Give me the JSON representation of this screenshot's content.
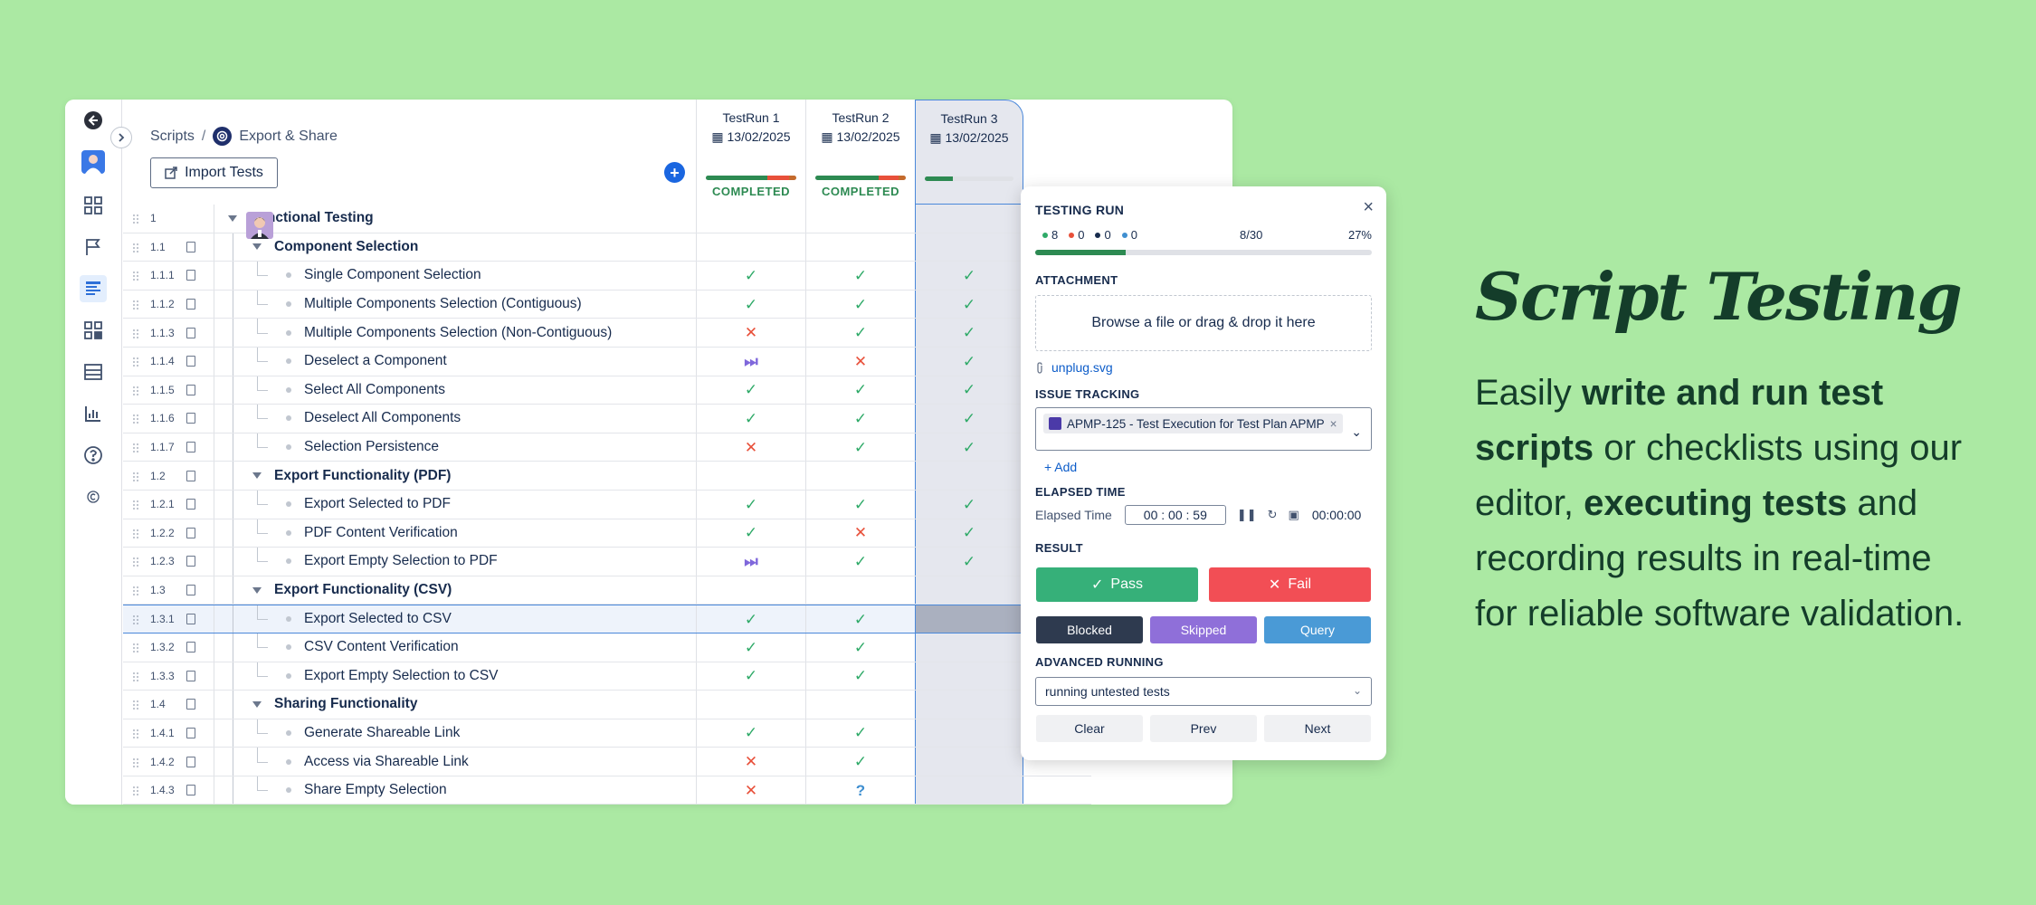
{
  "breadcrumb": {
    "root": "Scripts",
    "separator": "/",
    "current": "Export & Share"
  },
  "toolbar": {
    "import_label": "Import Tests",
    "add_label": "+"
  },
  "runs": [
    {
      "name": "TestRun 1",
      "date": "13/02/2025",
      "status": "COMPLETED",
      "progress": {
        "pass": 0.68,
        "fail": 0.24,
        "other": 0.08
      }
    },
    {
      "name": "TestRun 2",
      "date": "13/02/2025",
      "status": "COMPLETED",
      "progress": {
        "pass": 0.7,
        "fail": 0.22,
        "other": 0.08
      }
    },
    {
      "name": "TestRun 3",
      "date": "13/02/2025",
      "status": "",
      "progress": {
        "pass": 0.32,
        "fail": 0,
        "other": 0
      }
    }
  ],
  "rows": [
    {
      "num": "1",
      "title": "Functional Testing",
      "level": 0,
      "group": true,
      "results": [
        "",
        "",
        ""
      ]
    },
    {
      "num": "1.1",
      "title": "Component Selection",
      "level": 1,
      "group": true,
      "results": [
        "",
        "",
        ""
      ]
    },
    {
      "num": "1.1.1",
      "title": "Single Component Selection",
      "level": 2,
      "group": false,
      "results": [
        "pass",
        "pass",
        "pass"
      ]
    },
    {
      "num": "1.1.2",
      "title": "Multiple Components Selection (Contiguous)",
      "level": 2,
      "group": false,
      "results": [
        "pass",
        "pass",
        "pass"
      ]
    },
    {
      "num": "1.1.3",
      "title": "Multiple Components Selection (Non-Contiguous)",
      "level": 2,
      "group": false,
      "results": [
        "fail",
        "pass",
        "pass"
      ]
    },
    {
      "num": "1.1.4",
      "title": "Deselect a Component",
      "level": 2,
      "group": false,
      "results": [
        "skip",
        "fail",
        "pass"
      ]
    },
    {
      "num": "1.1.5",
      "title": "Select All Components",
      "level": 2,
      "group": false,
      "results": [
        "pass",
        "pass",
        "pass"
      ]
    },
    {
      "num": "1.1.6",
      "title": "Deselect All Components",
      "level": 2,
      "group": false,
      "results": [
        "pass",
        "pass",
        "pass"
      ]
    },
    {
      "num": "1.1.7",
      "title": "Selection Persistence",
      "level": 2,
      "group": false,
      "results": [
        "fail",
        "pass",
        "pass"
      ]
    },
    {
      "num": "1.2",
      "title": "Export Functionality (PDF)",
      "level": 1,
      "group": true,
      "results": [
        "",
        "",
        ""
      ]
    },
    {
      "num": "1.2.1",
      "title": "Export Selected to PDF",
      "level": 2,
      "group": false,
      "results": [
        "pass",
        "pass",
        "pass"
      ]
    },
    {
      "num": "1.2.2",
      "title": "PDF Content Verification",
      "level": 2,
      "group": false,
      "results": [
        "pass",
        "fail",
        "pass"
      ]
    },
    {
      "num": "1.2.3",
      "title": "Export Empty Selection to PDF",
      "level": 2,
      "group": false,
      "results": [
        "skip",
        "pass",
        "pass"
      ]
    },
    {
      "num": "1.3",
      "title": "Export Functionality (CSV)",
      "level": 1,
      "group": true,
      "results": [
        "",
        "",
        ""
      ]
    },
    {
      "num": "1.3.1",
      "title": "Export Selected to CSV",
      "level": 2,
      "group": false,
      "selected": true,
      "results": [
        "pass",
        "pass",
        ""
      ]
    },
    {
      "num": "1.3.2",
      "title": "CSV Content Verification",
      "level": 2,
      "group": false,
      "results": [
        "pass",
        "pass",
        ""
      ]
    },
    {
      "num": "1.3.3",
      "title": "Export Empty Selection to CSV",
      "level": 2,
      "group": false,
      "results": [
        "pass",
        "pass",
        ""
      ]
    },
    {
      "num": "1.4",
      "title": "Sharing Functionality",
      "level": 1,
      "group": true,
      "results": [
        "",
        "",
        ""
      ]
    },
    {
      "num": "1.4.1",
      "title": "Generate Shareable Link",
      "level": 2,
      "group": false,
      "results": [
        "pass",
        "pass",
        ""
      ]
    },
    {
      "num": "1.4.2",
      "title": "Access via Shareable Link",
      "level": 2,
      "group": false,
      "results": [
        "fail",
        "pass",
        ""
      ]
    },
    {
      "num": "1.4.3",
      "title": "Share Empty Selection",
      "level": 2,
      "group": false,
      "results": [
        "fail",
        "query",
        ""
      ]
    }
  ],
  "marks": {
    "pass": "✓",
    "fail": "✕",
    "skip": "⏭",
    "query": "?"
  },
  "panel": {
    "title": "TESTING RUN",
    "close_label": "×",
    "counts": [
      {
        "value": "8",
        "color": "#2faa68"
      },
      {
        "value": "0",
        "color": "#e8503a"
      },
      {
        "value": "0",
        "color": "#172b4d"
      },
      {
        "value": "0",
        "color": "#3f8fd0"
      }
    ],
    "ratio": "8/30",
    "percent": "27%",
    "progress": 0.27,
    "attachment_label": "ATTACHMENT",
    "dropzone": "Browse a file or drag & drop it here",
    "file_name": "unplug.svg",
    "issue_label": "ISSUE TRACKING",
    "issue_tag": "APMP-125 - Test Execution for Test Plan APMP",
    "issue_remove": "×",
    "add_label": "Add",
    "elapsed_section": "ELAPSED TIME",
    "elapsed_label": "Elapsed Time",
    "timer": "00 : 00 : 59",
    "total_time": "00:00:00",
    "result_label": "RESULT",
    "pass_label": "Pass",
    "fail_label": "Fail",
    "blocked_label": "Blocked",
    "skipped_label": "Skipped",
    "query_label": "Query",
    "advanced_label": "ADVANCED RUNNING",
    "advanced_value": "running untested tests",
    "clear_label": "Clear",
    "prev_label": "Prev",
    "next_label": "Next"
  },
  "marketing": {
    "heading": "Script Testing",
    "desc_1": "Easily ",
    "desc_bold_1": "write and run test scripts",
    "desc_2": " or checklists using our editor, ",
    "desc_bold_2": "executing tests",
    "desc_3": " and recording results in real-time for reliable software validation."
  },
  "colors": {
    "background": "#abe9a3",
    "accent": "#1a66e0",
    "pass": "#2faa68",
    "fail": "#e8503a",
    "blocked": "#2e3a4f",
    "skipped": "#8f6fd9",
    "query": "#4a9ad6"
  }
}
